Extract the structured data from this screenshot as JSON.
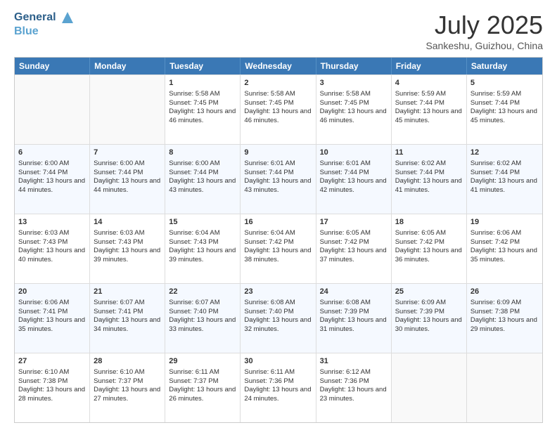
{
  "header": {
    "logo_line1": "General",
    "logo_line2": "Blue",
    "month_title": "July 2025",
    "subtitle": "Sankeshu, Guizhou, China"
  },
  "weekdays": [
    "Sunday",
    "Monday",
    "Tuesday",
    "Wednesday",
    "Thursday",
    "Friday",
    "Saturday"
  ],
  "rows": [
    [
      {
        "day": "",
        "sunrise": "",
        "sunset": "",
        "daylight": "",
        "empty": true
      },
      {
        "day": "",
        "sunrise": "",
        "sunset": "",
        "daylight": "",
        "empty": true
      },
      {
        "day": "1",
        "sunrise": "Sunrise: 5:58 AM",
        "sunset": "Sunset: 7:45 PM",
        "daylight": "Daylight: 13 hours and 46 minutes."
      },
      {
        "day": "2",
        "sunrise": "Sunrise: 5:58 AM",
        "sunset": "Sunset: 7:45 PM",
        "daylight": "Daylight: 13 hours and 46 minutes."
      },
      {
        "day": "3",
        "sunrise": "Sunrise: 5:58 AM",
        "sunset": "Sunset: 7:45 PM",
        "daylight": "Daylight: 13 hours and 46 minutes."
      },
      {
        "day": "4",
        "sunrise": "Sunrise: 5:59 AM",
        "sunset": "Sunset: 7:44 PM",
        "daylight": "Daylight: 13 hours and 45 minutes."
      },
      {
        "day": "5",
        "sunrise": "Sunrise: 5:59 AM",
        "sunset": "Sunset: 7:44 PM",
        "daylight": "Daylight: 13 hours and 45 minutes."
      }
    ],
    [
      {
        "day": "6",
        "sunrise": "Sunrise: 6:00 AM",
        "sunset": "Sunset: 7:44 PM",
        "daylight": "Daylight: 13 hours and 44 minutes."
      },
      {
        "day": "7",
        "sunrise": "Sunrise: 6:00 AM",
        "sunset": "Sunset: 7:44 PM",
        "daylight": "Daylight: 13 hours and 44 minutes."
      },
      {
        "day": "8",
        "sunrise": "Sunrise: 6:00 AM",
        "sunset": "Sunset: 7:44 PM",
        "daylight": "Daylight: 13 hours and 43 minutes."
      },
      {
        "day": "9",
        "sunrise": "Sunrise: 6:01 AM",
        "sunset": "Sunset: 7:44 PM",
        "daylight": "Daylight: 13 hours and 43 minutes."
      },
      {
        "day": "10",
        "sunrise": "Sunrise: 6:01 AM",
        "sunset": "Sunset: 7:44 PM",
        "daylight": "Daylight: 13 hours and 42 minutes."
      },
      {
        "day": "11",
        "sunrise": "Sunrise: 6:02 AM",
        "sunset": "Sunset: 7:44 PM",
        "daylight": "Daylight: 13 hours and 41 minutes."
      },
      {
        "day": "12",
        "sunrise": "Sunrise: 6:02 AM",
        "sunset": "Sunset: 7:44 PM",
        "daylight": "Daylight: 13 hours and 41 minutes."
      }
    ],
    [
      {
        "day": "13",
        "sunrise": "Sunrise: 6:03 AM",
        "sunset": "Sunset: 7:43 PM",
        "daylight": "Daylight: 13 hours and 40 minutes."
      },
      {
        "day": "14",
        "sunrise": "Sunrise: 6:03 AM",
        "sunset": "Sunset: 7:43 PM",
        "daylight": "Daylight: 13 hours and 39 minutes."
      },
      {
        "day": "15",
        "sunrise": "Sunrise: 6:04 AM",
        "sunset": "Sunset: 7:43 PM",
        "daylight": "Daylight: 13 hours and 39 minutes."
      },
      {
        "day": "16",
        "sunrise": "Sunrise: 6:04 AM",
        "sunset": "Sunset: 7:42 PM",
        "daylight": "Daylight: 13 hours and 38 minutes."
      },
      {
        "day": "17",
        "sunrise": "Sunrise: 6:05 AM",
        "sunset": "Sunset: 7:42 PM",
        "daylight": "Daylight: 13 hours and 37 minutes."
      },
      {
        "day": "18",
        "sunrise": "Sunrise: 6:05 AM",
        "sunset": "Sunset: 7:42 PM",
        "daylight": "Daylight: 13 hours and 36 minutes."
      },
      {
        "day": "19",
        "sunrise": "Sunrise: 6:06 AM",
        "sunset": "Sunset: 7:42 PM",
        "daylight": "Daylight: 13 hours and 35 minutes."
      }
    ],
    [
      {
        "day": "20",
        "sunrise": "Sunrise: 6:06 AM",
        "sunset": "Sunset: 7:41 PM",
        "daylight": "Daylight: 13 hours and 35 minutes."
      },
      {
        "day": "21",
        "sunrise": "Sunrise: 6:07 AM",
        "sunset": "Sunset: 7:41 PM",
        "daylight": "Daylight: 13 hours and 34 minutes."
      },
      {
        "day": "22",
        "sunrise": "Sunrise: 6:07 AM",
        "sunset": "Sunset: 7:40 PM",
        "daylight": "Daylight: 13 hours and 33 minutes."
      },
      {
        "day": "23",
        "sunrise": "Sunrise: 6:08 AM",
        "sunset": "Sunset: 7:40 PM",
        "daylight": "Daylight: 13 hours and 32 minutes."
      },
      {
        "day": "24",
        "sunrise": "Sunrise: 6:08 AM",
        "sunset": "Sunset: 7:39 PM",
        "daylight": "Daylight: 13 hours and 31 minutes."
      },
      {
        "day": "25",
        "sunrise": "Sunrise: 6:09 AM",
        "sunset": "Sunset: 7:39 PM",
        "daylight": "Daylight: 13 hours and 30 minutes."
      },
      {
        "day": "26",
        "sunrise": "Sunrise: 6:09 AM",
        "sunset": "Sunset: 7:38 PM",
        "daylight": "Daylight: 13 hours and 29 minutes."
      }
    ],
    [
      {
        "day": "27",
        "sunrise": "Sunrise: 6:10 AM",
        "sunset": "Sunset: 7:38 PM",
        "daylight": "Daylight: 13 hours and 28 minutes."
      },
      {
        "day": "28",
        "sunrise": "Sunrise: 6:10 AM",
        "sunset": "Sunset: 7:37 PM",
        "daylight": "Daylight: 13 hours and 27 minutes."
      },
      {
        "day": "29",
        "sunrise": "Sunrise: 6:11 AM",
        "sunset": "Sunset: 7:37 PM",
        "daylight": "Daylight: 13 hours and 26 minutes."
      },
      {
        "day": "30",
        "sunrise": "Sunrise: 6:11 AM",
        "sunset": "Sunset: 7:36 PM",
        "daylight": "Daylight: 13 hours and 24 minutes."
      },
      {
        "day": "31",
        "sunrise": "Sunrise: 6:12 AM",
        "sunset": "Sunset: 7:36 PM",
        "daylight": "Daylight: 13 hours and 23 minutes."
      },
      {
        "day": "",
        "sunrise": "",
        "sunset": "",
        "daylight": "",
        "empty": true
      },
      {
        "day": "",
        "sunrise": "",
        "sunset": "",
        "daylight": "",
        "empty": true
      }
    ]
  ]
}
